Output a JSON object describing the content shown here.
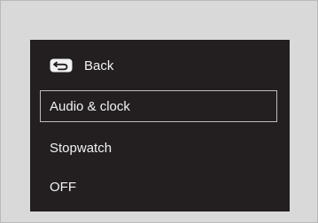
{
  "menu": {
    "items": [
      {
        "label": "Back",
        "icon": "back-arrow-icon"
      },
      {
        "label": "Audio & clock",
        "selected": true
      },
      {
        "label": "Stopwatch"
      },
      {
        "label": "OFF"
      }
    ]
  },
  "colors": {
    "outer_background": "#d9d9d9",
    "screen_background": "#231f20",
    "text": "#f2f2f2",
    "selection_border": "#bdbdbd"
  }
}
